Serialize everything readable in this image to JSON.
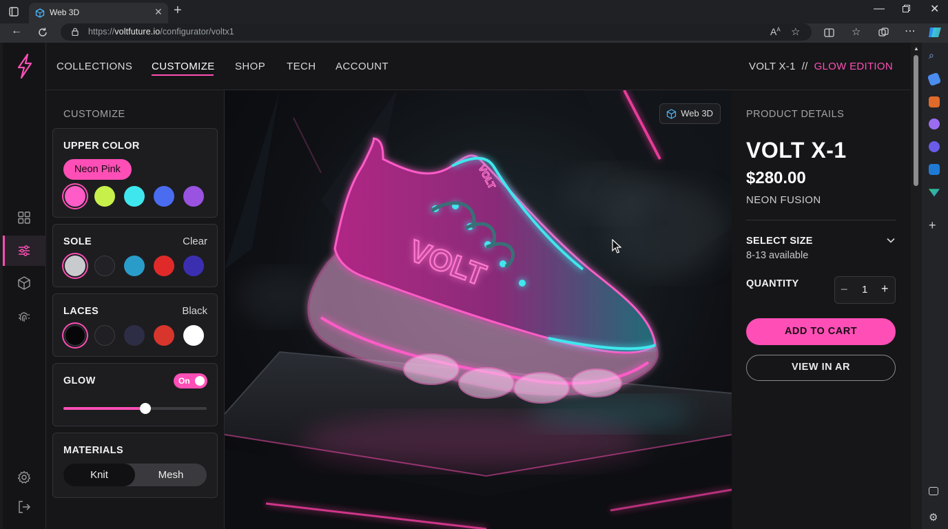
{
  "browser": {
    "tab_title": "Web 3D",
    "url_prefix": "https://",
    "url_domain": "voltfuture.io",
    "url_path": "/configurator/voltx1"
  },
  "nav": {
    "links": [
      "COLLECTIONS",
      "CUSTOMIZE",
      "SHOP",
      "TECH",
      "ACCOUNT"
    ],
    "active": "CUSTOMIZE",
    "brand_model": "VOLT X-1",
    "brand_separator": "//",
    "brand_edition": "GLOW EDITION"
  },
  "customize": {
    "heading": "CUSTOMIZE",
    "upper": {
      "title": "UPPER COLOR",
      "selected_label": "Neon Pink",
      "swatches": [
        "#ff5cc8",
        "#c8f04a",
        "#3fe6ee",
        "#4a6cf0",
        "#9a52e0"
      ],
      "selected_index": 0
    },
    "sole": {
      "title": "SOLE",
      "value": "Clear",
      "swatches": [
        "#c9cacd",
        "#222226",
        "#2a9cc9",
        "#e02a2a",
        "#3b2fb0"
      ],
      "selected_index": 0
    },
    "laces": {
      "title": "LACES",
      "value": "Black",
      "swatches": [
        "#070709",
        "#1f1f24",
        "#2d2e45",
        "#d8352c",
        "#ffffff"
      ],
      "selected_index": 0
    },
    "glow": {
      "title": "GLOW",
      "toggle_label": "On",
      "level_fraction": 0.57
    },
    "materials": {
      "title": "MATERIALS",
      "options": [
        "Knit",
        "Mesh"
      ],
      "selected": "Knit"
    }
  },
  "viewer": {
    "badge": "Web 3D"
  },
  "details": {
    "heading": "PRODUCT DETAILS",
    "name": "VOLT X-1",
    "price": "$280.00",
    "variant": "NEON FUSION",
    "size_label": "SELECT SIZE",
    "size_available": "8-13 available",
    "quantity_label": "QUANTITY",
    "quantity_minus": "−",
    "quantity_value": "1",
    "quantity_plus": "+",
    "add_to_cart": "ADD TO CART",
    "view_in_ar": "VIEW IN AR"
  },
  "colors": {
    "accent": "#ff4fb6",
    "cyan": "#3fe6ee"
  }
}
